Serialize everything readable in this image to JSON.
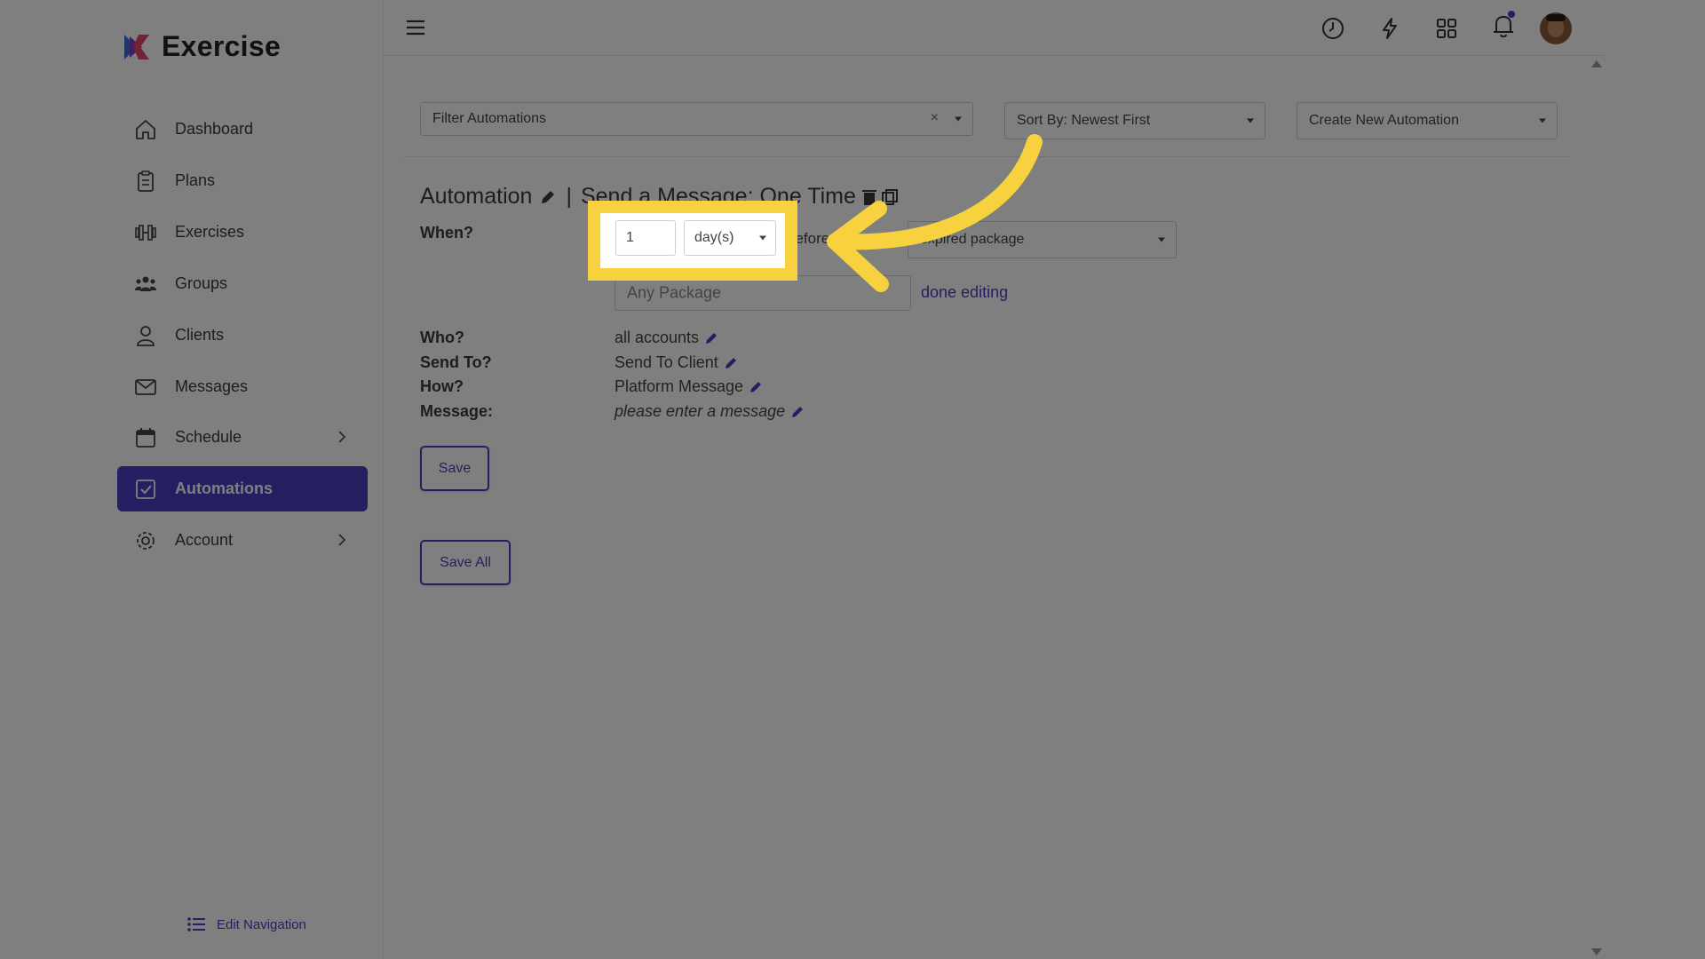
{
  "app": {
    "name": "Exercise"
  },
  "sidebar": {
    "items": [
      {
        "label": "Dashboard",
        "icon": "home-icon"
      },
      {
        "label": "Plans",
        "icon": "clipboard-icon"
      },
      {
        "label": "Exercises",
        "icon": "dumbbell-icon"
      },
      {
        "label": "Groups",
        "icon": "group-icon"
      },
      {
        "label": "Clients",
        "icon": "person-icon"
      },
      {
        "label": "Messages",
        "icon": "envelope-icon"
      },
      {
        "label": "Schedule",
        "icon": "calendar-icon",
        "has_submenu": true
      },
      {
        "label": "Automations",
        "icon": "checkbox-icon",
        "active": true
      },
      {
        "label": "Account",
        "icon": "gear-icon",
        "has_submenu": true
      }
    ],
    "edit_navigation": "Edit Navigation"
  },
  "toolbar": {
    "filter": {
      "placeholder": "Filter Automations",
      "clear": "×"
    },
    "sort": "Sort By: Newest First",
    "create": "Create New Automation"
  },
  "automation": {
    "title_prefix": "Automation",
    "separator": "|",
    "title_suffix": "Send a Message: One Time",
    "when_label": "When?",
    "when_amount": "1",
    "when_unit": "day(s)",
    "when_relation": "before",
    "when_event": "expired package",
    "package_placeholder": "Any Package",
    "done_editing": "done editing",
    "who_label": "Who?",
    "who_value": "all accounts",
    "send_to_label": "Send To?",
    "send_to_value": "Send To Client",
    "how_label": "How?",
    "how_value": "Platform Message",
    "message_label": "Message:",
    "message_value": "please enter a message",
    "save": "Save",
    "save_all": "Save All"
  },
  "colors": {
    "accent": "#4a3fc4",
    "highlight": "#f7d23e",
    "link": "#4a3fc4"
  }
}
